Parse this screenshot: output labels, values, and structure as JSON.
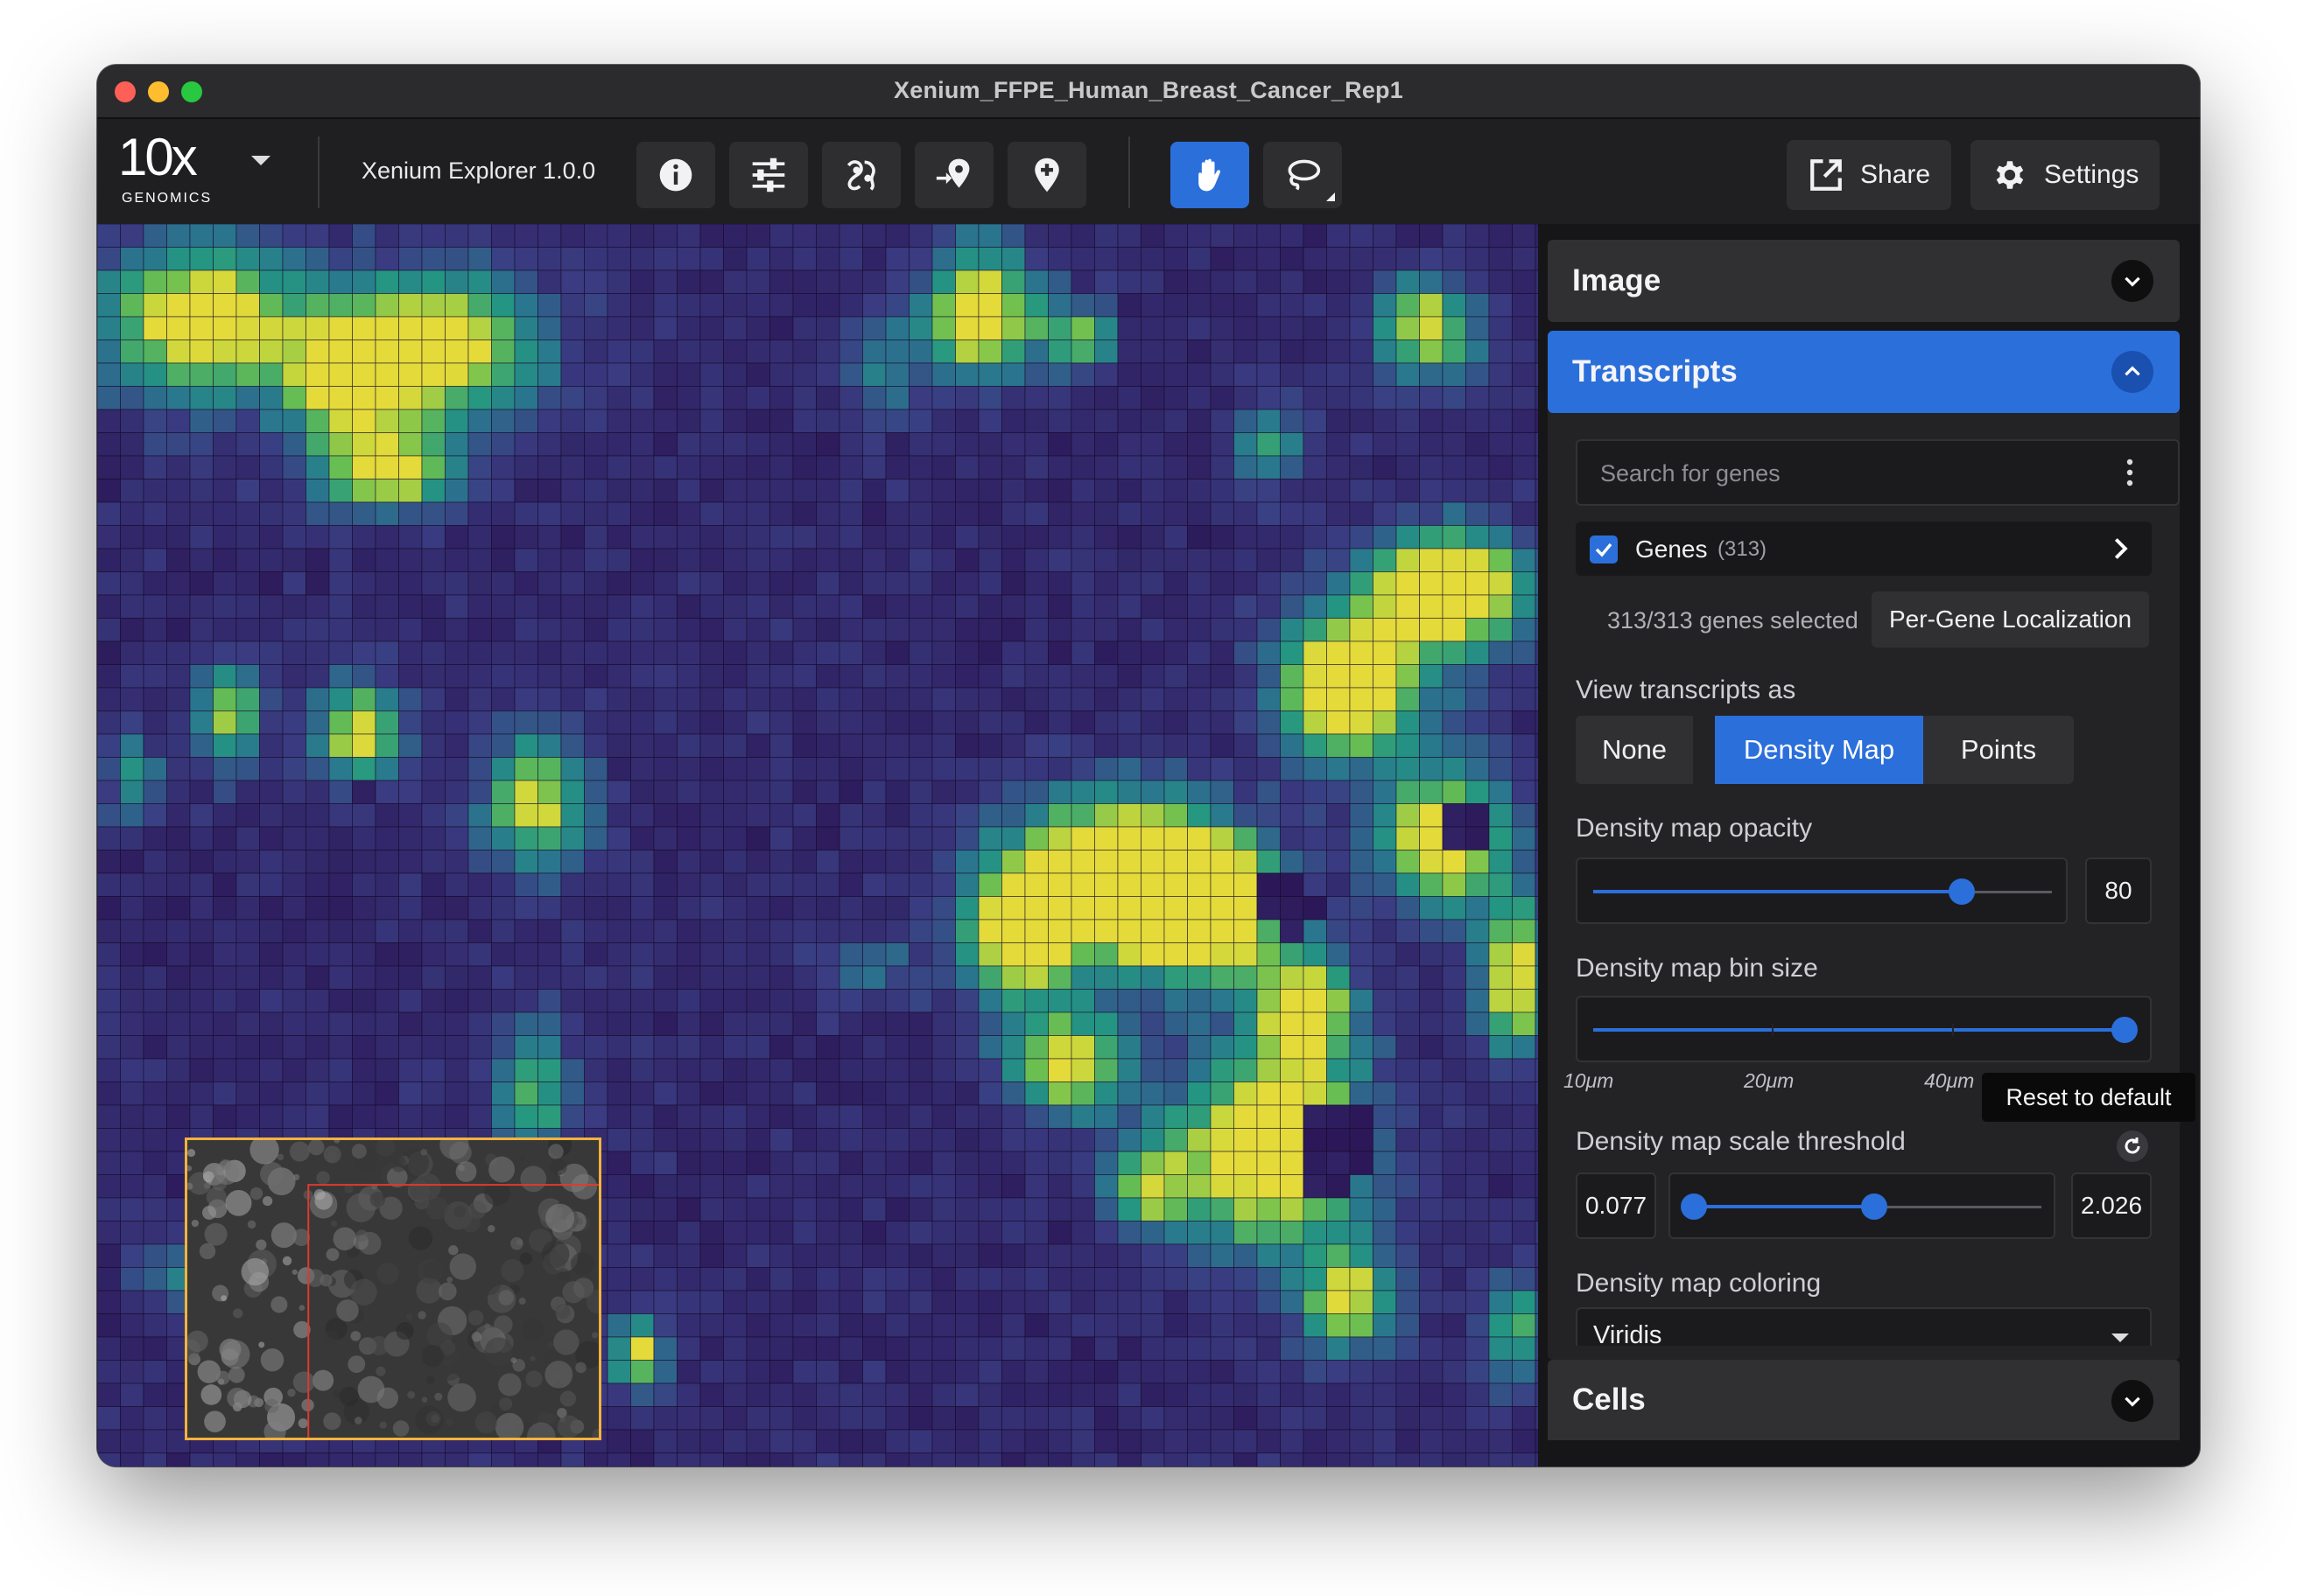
{
  "window": {
    "title": "Xenium_FFPE_Human_Breast_Cancer_Rep1"
  },
  "toolbar": {
    "logo_text": "10x",
    "logo_sub": "GENOMICS",
    "app_version": "Xenium Explorer 1.0.0",
    "buttons": {
      "info": "info-icon",
      "adjust": "sliders-icon",
      "cell_segmentation": "cells-icon",
      "goto_location": "goto-location-icon",
      "add_pin": "add-pin-icon",
      "pan": "hand-icon",
      "lasso": "lasso-icon"
    },
    "share_label": "Share",
    "settings_label": "Settings"
  },
  "panel": {
    "image_label": "Image",
    "transcripts_label": "Transcripts",
    "cells_label": "Cells",
    "search_placeholder": "Search for genes",
    "genes_label": "Genes",
    "genes_count": "(313)",
    "genes_checked": true,
    "genes_selected": "313/313 genes selected",
    "per_gene_button": "Per-Gene Localization",
    "view_as_label": "View transcripts as",
    "view_as_options": [
      "None",
      "Density Map",
      "Points"
    ],
    "view_as_selected": "Density Map",
    "opacity_label": "Density map opacity",
    "opacity_value": "80",
    "bin_size_label": "Density map bin size",
    "bin_ticks": [
      "10μm",
      "20μm",
      "40μm"
    ],
    "bin_tooltip": "Reset to default",
    "threshold_label": "Density map scale threshold",
    "threshold_min": "0.077",
    "threshold_max": "2.026",
    "coloring_label": "Density map coloring",
    "coloring_value": "Viridis"
  },
  "colors": {
    "accent": "#2b6fdb",
    "viridis_low": "#2d1c5a",
    "viridis_mid": "#2a8c8a",
    "viridis_high": "#e0d83a"
  }
}
